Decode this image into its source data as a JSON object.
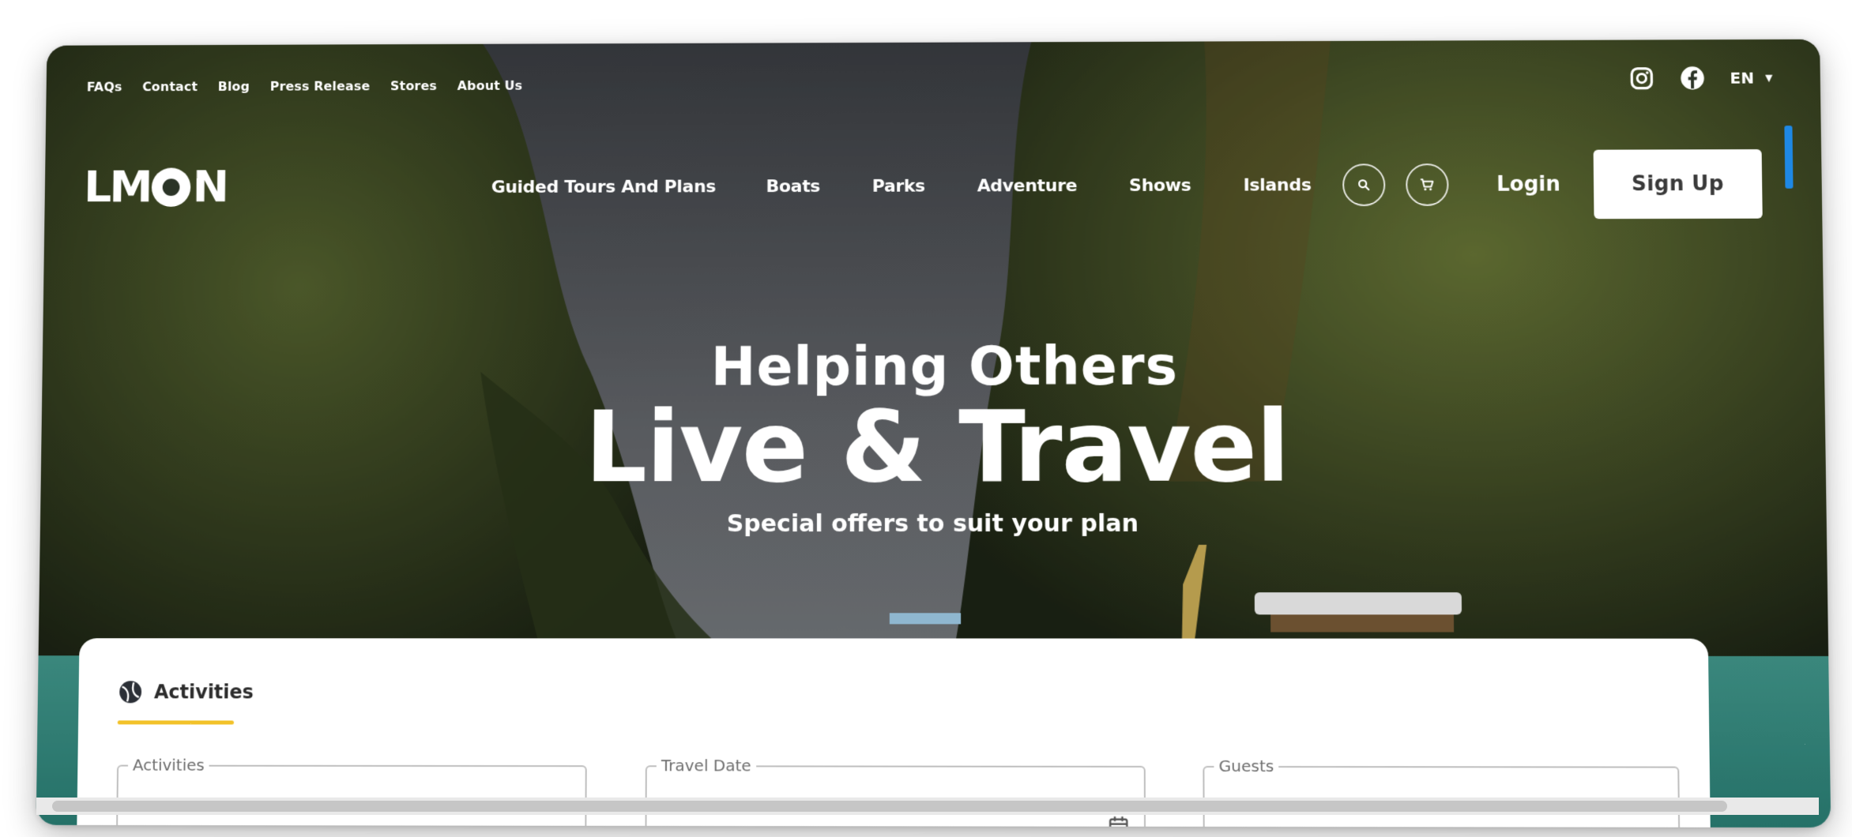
{
  "brand": {
    "logo_text_left": "LM",
    "logo_text_right": "N"
  },
  "topbar": {
    "links": [
      "FAQs",
      "Contact",
      "Blog",
      "Press Release",
      "Stores",
      "About Us"
    ],
    "language": "EN",
    "social_icons": [
      "instagram-icon",
      "facebook-icon"
    ]
  },
  "nav": {
    "items": [
      "Guided Tours And Plans",
      "Boats",
      "Parks",
      "Adventure",
      "Shows",
      "Islands"
    ],
    "search_icon": "search-icon",
    "cart_icon": "cart-icon",
    "login_label": "Login",
    "signup_label": "Sign Up"
  },
  "hero": {
    "line1": "Helping Others",
    "line2": "Live & Travel",
    "subtitle": "Special offers to suit your plan"
  },
  "search": {
    "tab_label": "Activities",
    "fields": [
      {
        "label": "Activities"
      },
      {
        "label": "Travel Date",
        "icon": "calendar-icon"
      },
      {
        "label": "Guests"
      }
    ]
  },
  "colors": {
    "accent_yellow": "#f2c229",
    "text_dark": "#2c2c2c",
    "white": "#ffffff"
  }
}
